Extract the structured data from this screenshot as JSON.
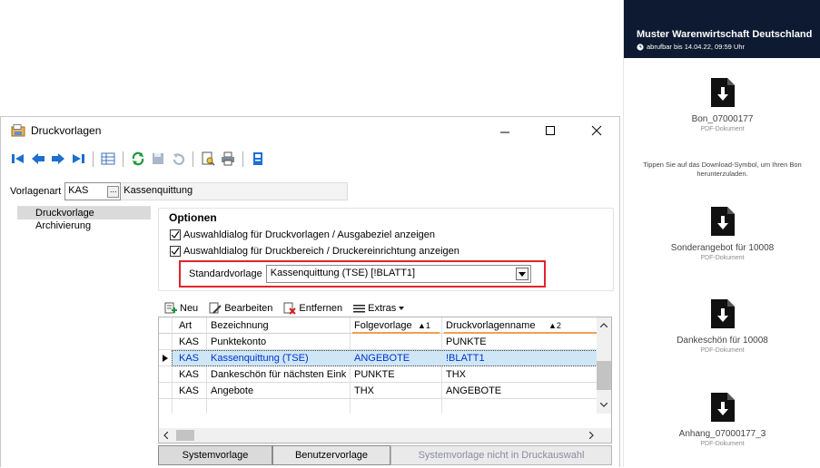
{
  "window": {
    "title": "Druckvorlagen",
    "controls": {
      "minimize": "–",
      "maximize": "☐",
      "close": "✕"
    }
  },
  "toolbar": {
    "icons": [
      "first-record-icon",
      "previous-record-icon",
      "next-record-icon",
      "last-record-icon",
      "table-view-icon",
      "refresh-icon",
      "save-icon",
      "undo-icon",
      "preview-icon",
      "print-icon",
      "template-icon"
    ]
  },
  "vorlagenart": {
    "label": "Vorlagenart",
    "code": "KAS",
    "browse": "...",
    "description": "Kassenquittung"
  },
  "nav": {
    "items": [
      {
        "label": "Druckvorlage",
        "selected": true
      },
      {
        "label": "Archivierung",
        "selected": false
      }
    ]
  },
  "options": {
    "heading": "Optionen",
    "checkbox1": "Auswahldialog für Druckvorlagen / Ausgabeziel anzeigen",
    "checkbox2": "Auswahldialog für Druckbereich / Druckereinrichtung anzeigen",
    "standard_label": "Standardvorlage",
    "standard_value": "Kassenquittung (TSE) [!BLATT1]"
  },
  "grid_toolbar": {
    "new": "Neu",
    "edit": "Bearbeiten",
    "remove": "Entfernen",
    "extras": "Extras"
  },
  "grid": {
    "columns": [
      "Art",
      "Bezeichnung",
      "Folgevorlage",
      "Druckvorlagenname"
    ],
    "sort_marks": [
      "▲1",
      "▲2"
    ],
    "rows": [
      [
        "KAS",
        "Punktekonto",
        "",
        "PUNKTE"
      ],
      [
        "KAS",
        "Kassenquittung (TSE)",
        "ANGEBOTE",
        "!BLATT1"
      ],
      [
        "KAS",
        "Dankeschön für nächsten Eink",
        "PUNKTE",
        "THX"
      ],
      [
        "KAS",
        "Angebote",
        "THX",
        "ANGEBOTE"
      ]
    ]
  },
  "bottom_buttons": {
    "system": "Systemvorlage",
    "user": "Benutzervorlage",
    "excluded": "Systemvorlage nicht in Druckauswahl"
  },
  "mobile": {
    "company": "Muster Warenwirtschaft Deutschland",
    "availability": "abrufbar bis 14.04.22, 09:59 Uhr",
    "hint": "Tippen Sie auf das Download-Symbol, um Ihren Bon herunterzuladen.",
    "documents": [
      {
        "name": "Bon_07000177",
        "type": "PDF-Dokument"
      },
      {
        "name": "Sonderangebot für 10008",
        "type": "PDF-Dokument"
      },
      {
        "name": "Dankeschön für 10008",
        "type": "PDF-Dokument"
      },
      {
        "name": "Anhang_07000177_3",
        "type": "PDF-Dokument"
      }
    ]
  },
  "colors": {
    "highlight_border": "#e0242b",
    "selected_row": "#cfe6f7",
    "mobile_header": "#0d1a31",
    "link_blue": "#0033cc"
  }
}
